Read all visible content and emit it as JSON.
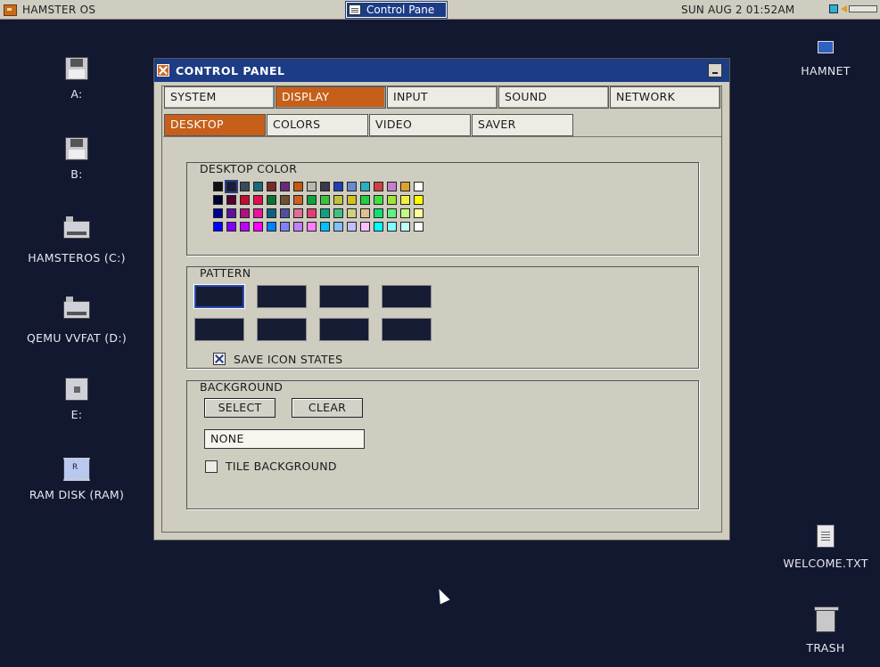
{
  "topbar": {
    "os_label": "HAMSTER OS",
    "task_label": "Control Pane",
    "clock": "SUN AUG 2 01:52AM"
  },
  "desktop_icons": [
    {
      "label": "A:",
      "icon": "floppy-icon"
    },
    {
      "label": "B:",
      "icon": "floppy-icon"
    },
    {
      "label": "HAMSTEROS (C:)",
      "icon": "hard-drive-icon"
    },
    {
      "label": "QEMU VVFAT (D:)",
      "icon": "hard-drive-icon"
    },
    {
      "label": "E:",
      "icon": "drive-icon"
    },
    {
      "label": "RAM DISK (RAM)",
      "icon": "ram-disk-icon"
    },
    {
      "label": "HAMNET",
      "icon": "network-icon"
    },
    {
      "label": "WELCOME.TXT",
      "icon": "text-file-icon"
    },
    {
      "label": "TRASH",
      "icon": "trash-icon"
    }
  ],
  "window": {
    "title": "CONTROL PANEL",
    "tabs": [
      "SYSTEM",
      "DISPLAY",
      "INPUT",
      "SOUND",
      "NETWORK"
    ],
    "active_tab": "DISPLAY",
    "subtabs": [
      "DESKTOP",
      "COLORS",
      "VIDEO",
      "SAVER"
    ],
    "active_subtab": "DESKTOP",
    "desktop_color": {
      "label": "DESKTOP COLOR",
      "selected_index": 1,
      "palette": [
        [
          "#111111",
          "#1a1a3a",
          "#3a4a5a",
          "#1a6a7a",
          "#7a2a2a",
          "#6a2a7a",
          "#c05a10",
          "#b8b8b0",
          "#3a3a4a",
          "#2040b0",
          "#6a8ad0",
          "#2ab0c0",
          "#d04040",
          "#c080d0",
          "#e0a030",
          "#ffffff"
        ],
        [
          "#000030",
          "#500030",
          "#c01030",
          "#e01050",
          "#107030",
          "#705030",
          "#d06020",
          "#10a040",
          "#40c040",
          "#c0c040",
          "#d0c020",
          "#20d040",
          "#40e040",
          "#a0e040",
          "#f0f040",
          "#ffff00"
        ],
        [
          "#000090",
          "#6010a0",
          "#b01080",
          "#f010a0",
          "#106080",
          "#5050a0",
          "#e07090",
          "#e04070",
          "#10a080",
          "#40c080",
          "#d0d080",
          "#e0c090",
          "#10e070",
          "#60f080",
          "#c0ff80",
          "#ffffa0"
        ],
        [
          "#0000ff",
          "#8000ff",
          "#c000ff",
          "#ff00ff",
          "#0080ff",
          "#8080ff",
          "#c080ff",
          "#ff80ff",
          "#00c0ff",
          "#80c0ff",
          "#c0c0ff",
          "#ffc0ff",
          "#00ffff",
          "#80ffff",
          "#c0ffff",
          "#ffffff"
        ]
      ]
    },
    "pattern": {
      "label": "PATTERN",
      "selected_index": 0,
      "count": 8,
      "save_icon_states_label": "SAVE ICON STATES",
      "save_icon_states_checked": true
    },
    "background": {
      "label": "BACKGROUND",
      "select_label": "SELECT",
      "clear_label": "CLEAR",
      "value": "NONE",
      "tile_label": "TILE BACKGROUND",
      "tile_checked": false
    }
  },
  "colors": {
    "desktop": "#121830",
    "titlebar": "#1c3c86",
    "accent": "#c65f19",
    "window_bg": "#cfccc0"
  }
}
